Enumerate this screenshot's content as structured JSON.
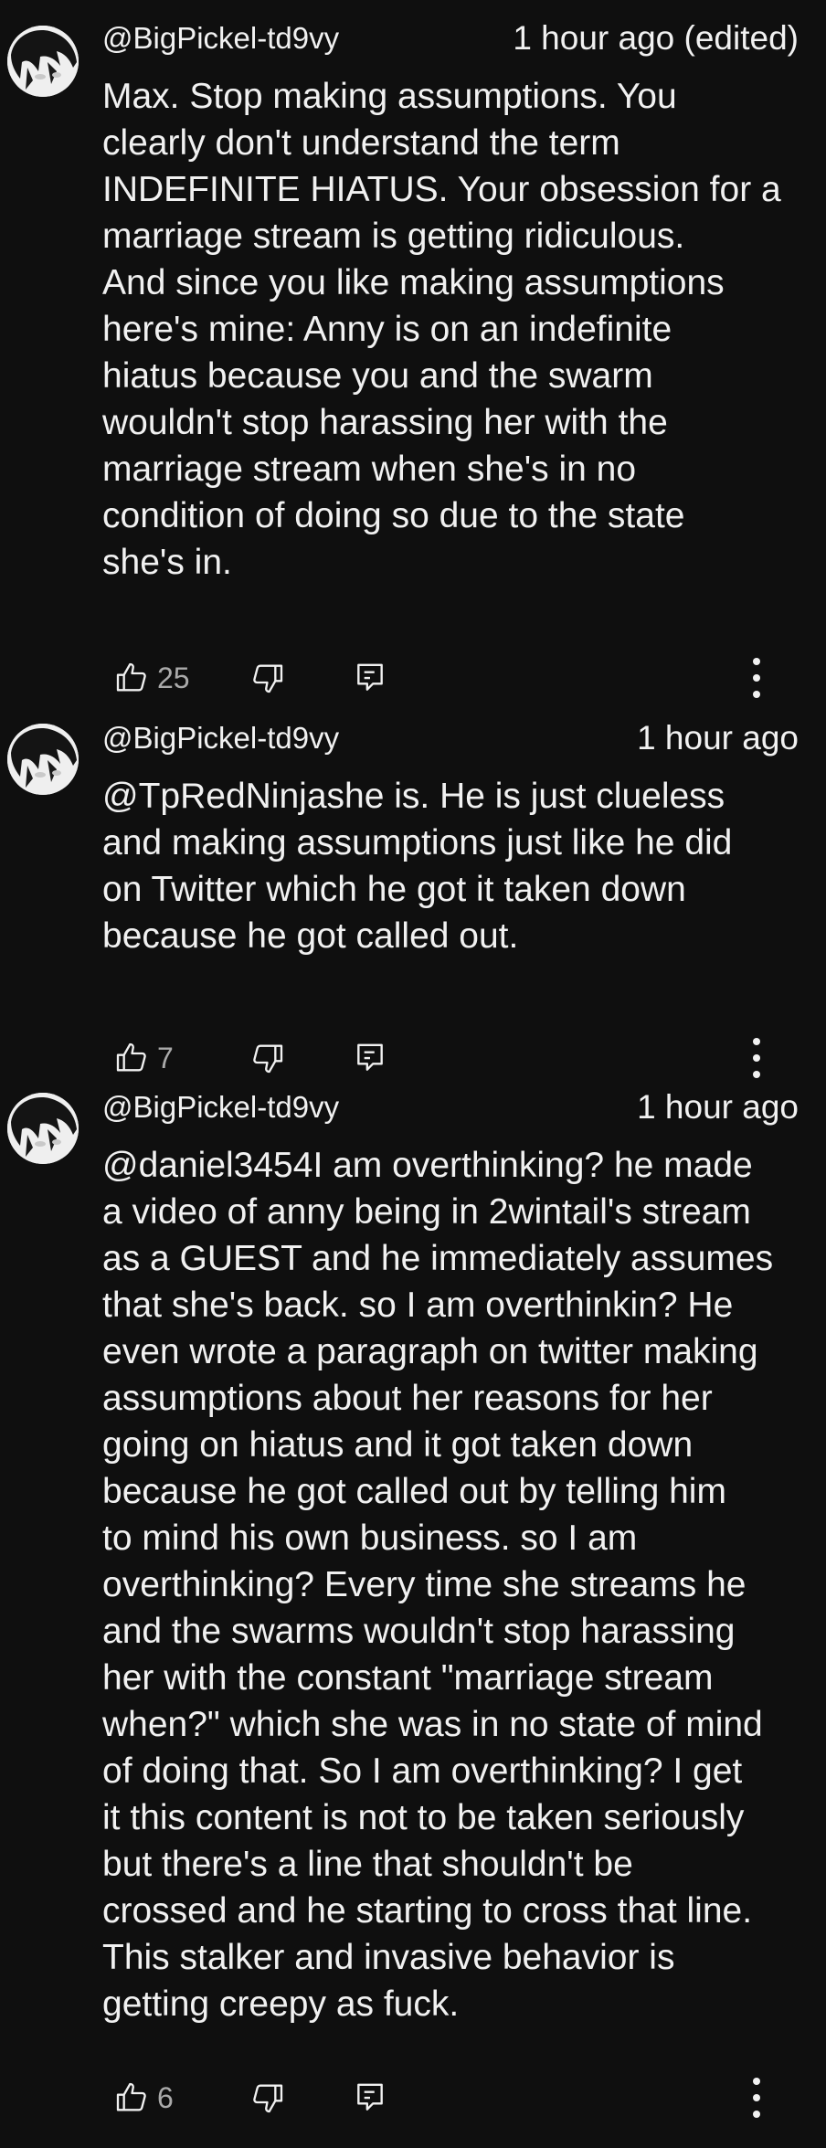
{
  "comments": [
    {
      "author": "@BigPickel-td9vy",
      "time": "1 hour ago (edited)",
      "lines": [
        "Max. Stop making assumptions. You",
        "clearly don't understand the term",
        "INDEFINITE HIATUS. Your obsession for a",
        "marriage stream is getting ridiculous.",
        "And since you like making assumptions",
        "here's mine: Anny is on an indefinite",
        "hiatus because you and the swarm",
        "wouldn't stop harassing her with the",
        "marriage stream when she's in no",
        "condition of doing so due to the state",
        "she's in."
      ],
      "likes": "25"
    },
    {
      "author": "@BigPickel-td9vy",
      "time": "1 hour ago",
      "lines": [
        "@TpRedNinjashe is. He is just clueless",
        "and making assumptions just like he did",
        "on Twitter which he got it taken down",
        "because he got called out."
      ],
      "likes": "7"
    },
    {
      "author": "@BigPickel-td9vy",
      "time": "1 hour ago",
      "lines": [
        "@daniel3454I am overthinking? he made",
        "a video of anny being in 2wintail's stream",
        "as a GUEST and he immediately assumes",
        "that she's back. so I am overthinkin? He",
        "even wrote a paragraph on twitter making",
        "assumptions about her reasons for her",
        "going on hiatus and it got taken down",
        "because he got called out by telling him",
        "to mind his own business. so I am",
        "overthinking? Every time she streams he",
        "and the swarms wouldn't stop harassing",
        "her with the constant \"marriage stream",
        "when?\" which she was in no state of mind",
        "of doing that. So I am overthinking? I get",
        "it this content is not to be taken seriously",
        "but there's a line that shouldn't be",
        "crossed and he starting to cross that line.",
        "This stalker and invasive behavior is",
        "getting creepy as fuck."
      ],
      "likes": "6"
    }
  ],
  "icons": {
    "avatar": "avatar-anime-icon",
    "like": "thumbs-up-icon",
    "dislike": "thumbs-down-icon",
    "reply": "reply-comment-icon",
    "more": "more-vertical-icon"
  },
  "colors": {
    "background": "#0f0f0f",
    "text": "#f1f1f1",
    "secondary": "#aaaaaa"
  }
}
